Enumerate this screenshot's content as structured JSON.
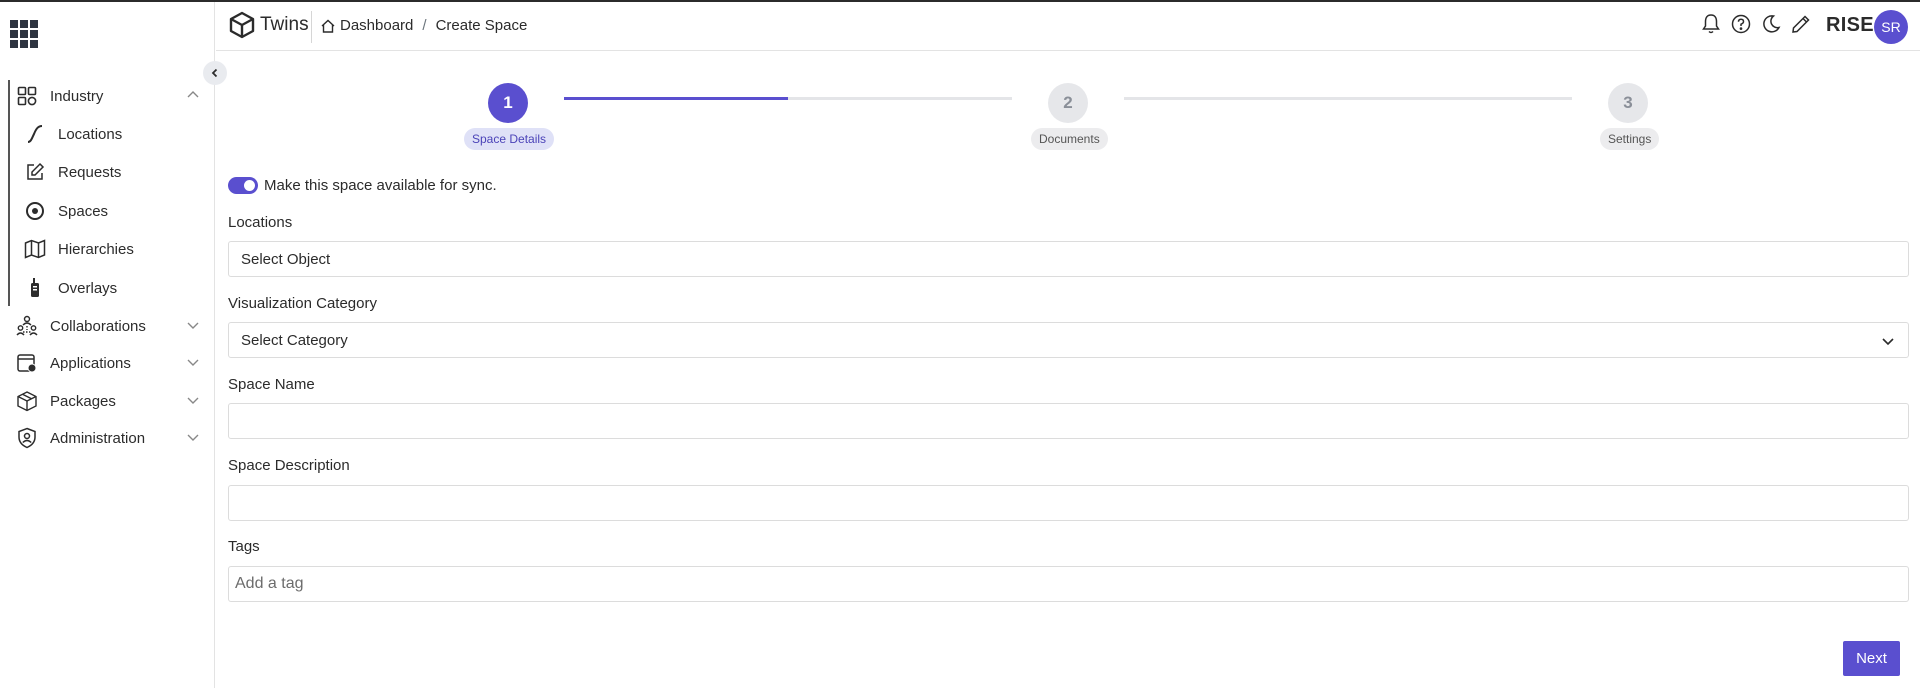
{
  "header": {
    "app_name": "Twins",
    "breadcrumb": {
      "home": "Dashboard",
      "separator": "/",
      "current": "Create Space"
    },
    "org": "RISE",
    "user_initials": "SR"
  },
  "sidebar": {
    "groups": [
      {
        "label": "Industry",
        "icon": "grid-icon",
        "expanded": true
      },
      {
        "label": "Collaborations",
        "icon": "people-icon"
      },
      {
        "label": "Applications",
        "icon": "applications-icon"
      },
      {
        "label": "Packages",
        "icon": "package-icon"
      },
      {
        "label": "Administration",
        "icon": "shield-user-icon"
      }
    ],
    "industry_items": [
      {
        "label": "Locations",
        "icon": "curve-icon"
      },
      {
        "label": "Requests",
        "icon": "edit-icon"
      },
      {
        "label": "Spaces",
        "icon": "target-icon"
      },
      {
        "label": "Hierarchies",
        "icon": "map-icon"
      },
      {
        "label": "Overlays",
        "icon": "walkie-talkie-icon"
      }
    ]
  },
  "stepper": {
    "steps": [
      {
        "number": "1",
        "label": "Space Details",
        "active": true
      },
      {
        "number": "2",
        "label": "Documents",
        "active": false
      },
      {
        "number": "3",
        "label": "Settings",
        "active": false
      }
    ],
    "progress_first_segment": 0.5
  },
  "form": {
    "sync_toggle": {
      "label": "Make this space available for sync.",
      "on": true
    },
    "locations": {
      "label": "Locations",
      "value": "Select Object"
    },
    "visualization_category": {
      "label": "Visualization Category",
      "value": "Select Category"
    },
    "space_name": {
      "label": "Space Name",
      "value": ""
    },
    "space_description": {
      "label": "Space Description",
      "value": ""
    },
    "tags": {
      "label": "Tags",
      "placeholder": "Add a tag"
    },
    "next_label": "Next"
  },
  "colors": {
    "accent": "#5a4fcf",
    "border": "#dcdcdc",
    "track": "#e4e5e8"
  }
}
